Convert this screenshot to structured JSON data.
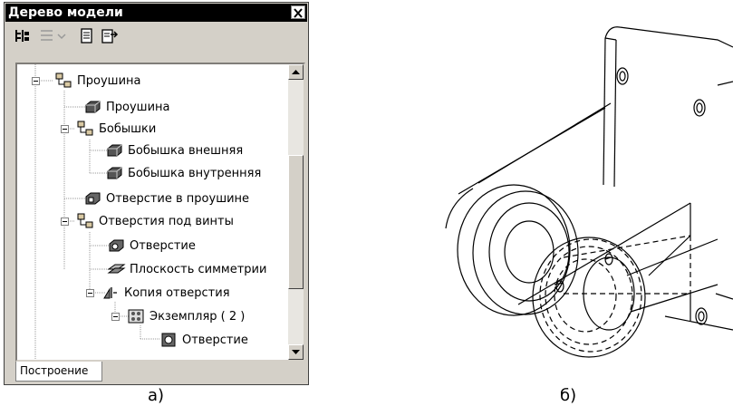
{
  "panel": {
    "title": "Дерево модели",
    "tab_label": "Построение",
    "items": [
      {
        "label": "Проушина"
      },
      {
        "label": "Проушина"
      },
      {
        "label": "Бобышки"
      },
      {
        "label": "Бобышка внешняя"
      },
      {
        "label": "Бобышка внутренняя"
      },
      {
        "label": "Отверстие в проушине"
      },
      {
        "label": "Отверстия под винты"
      },
      {
        "label": "Отверстие"
      },
      {
        "label": "Плоскость симметрии"
      },
      {
        "label": "Копия отверстия"
      },
      {
        "label": "Экземпляр ( 2 )"
      },
      {
        "label": "Отверстие"
      }
    ]
  },
  "captions": {
    "a": "а)",
    "b": "б)"
  }
}
